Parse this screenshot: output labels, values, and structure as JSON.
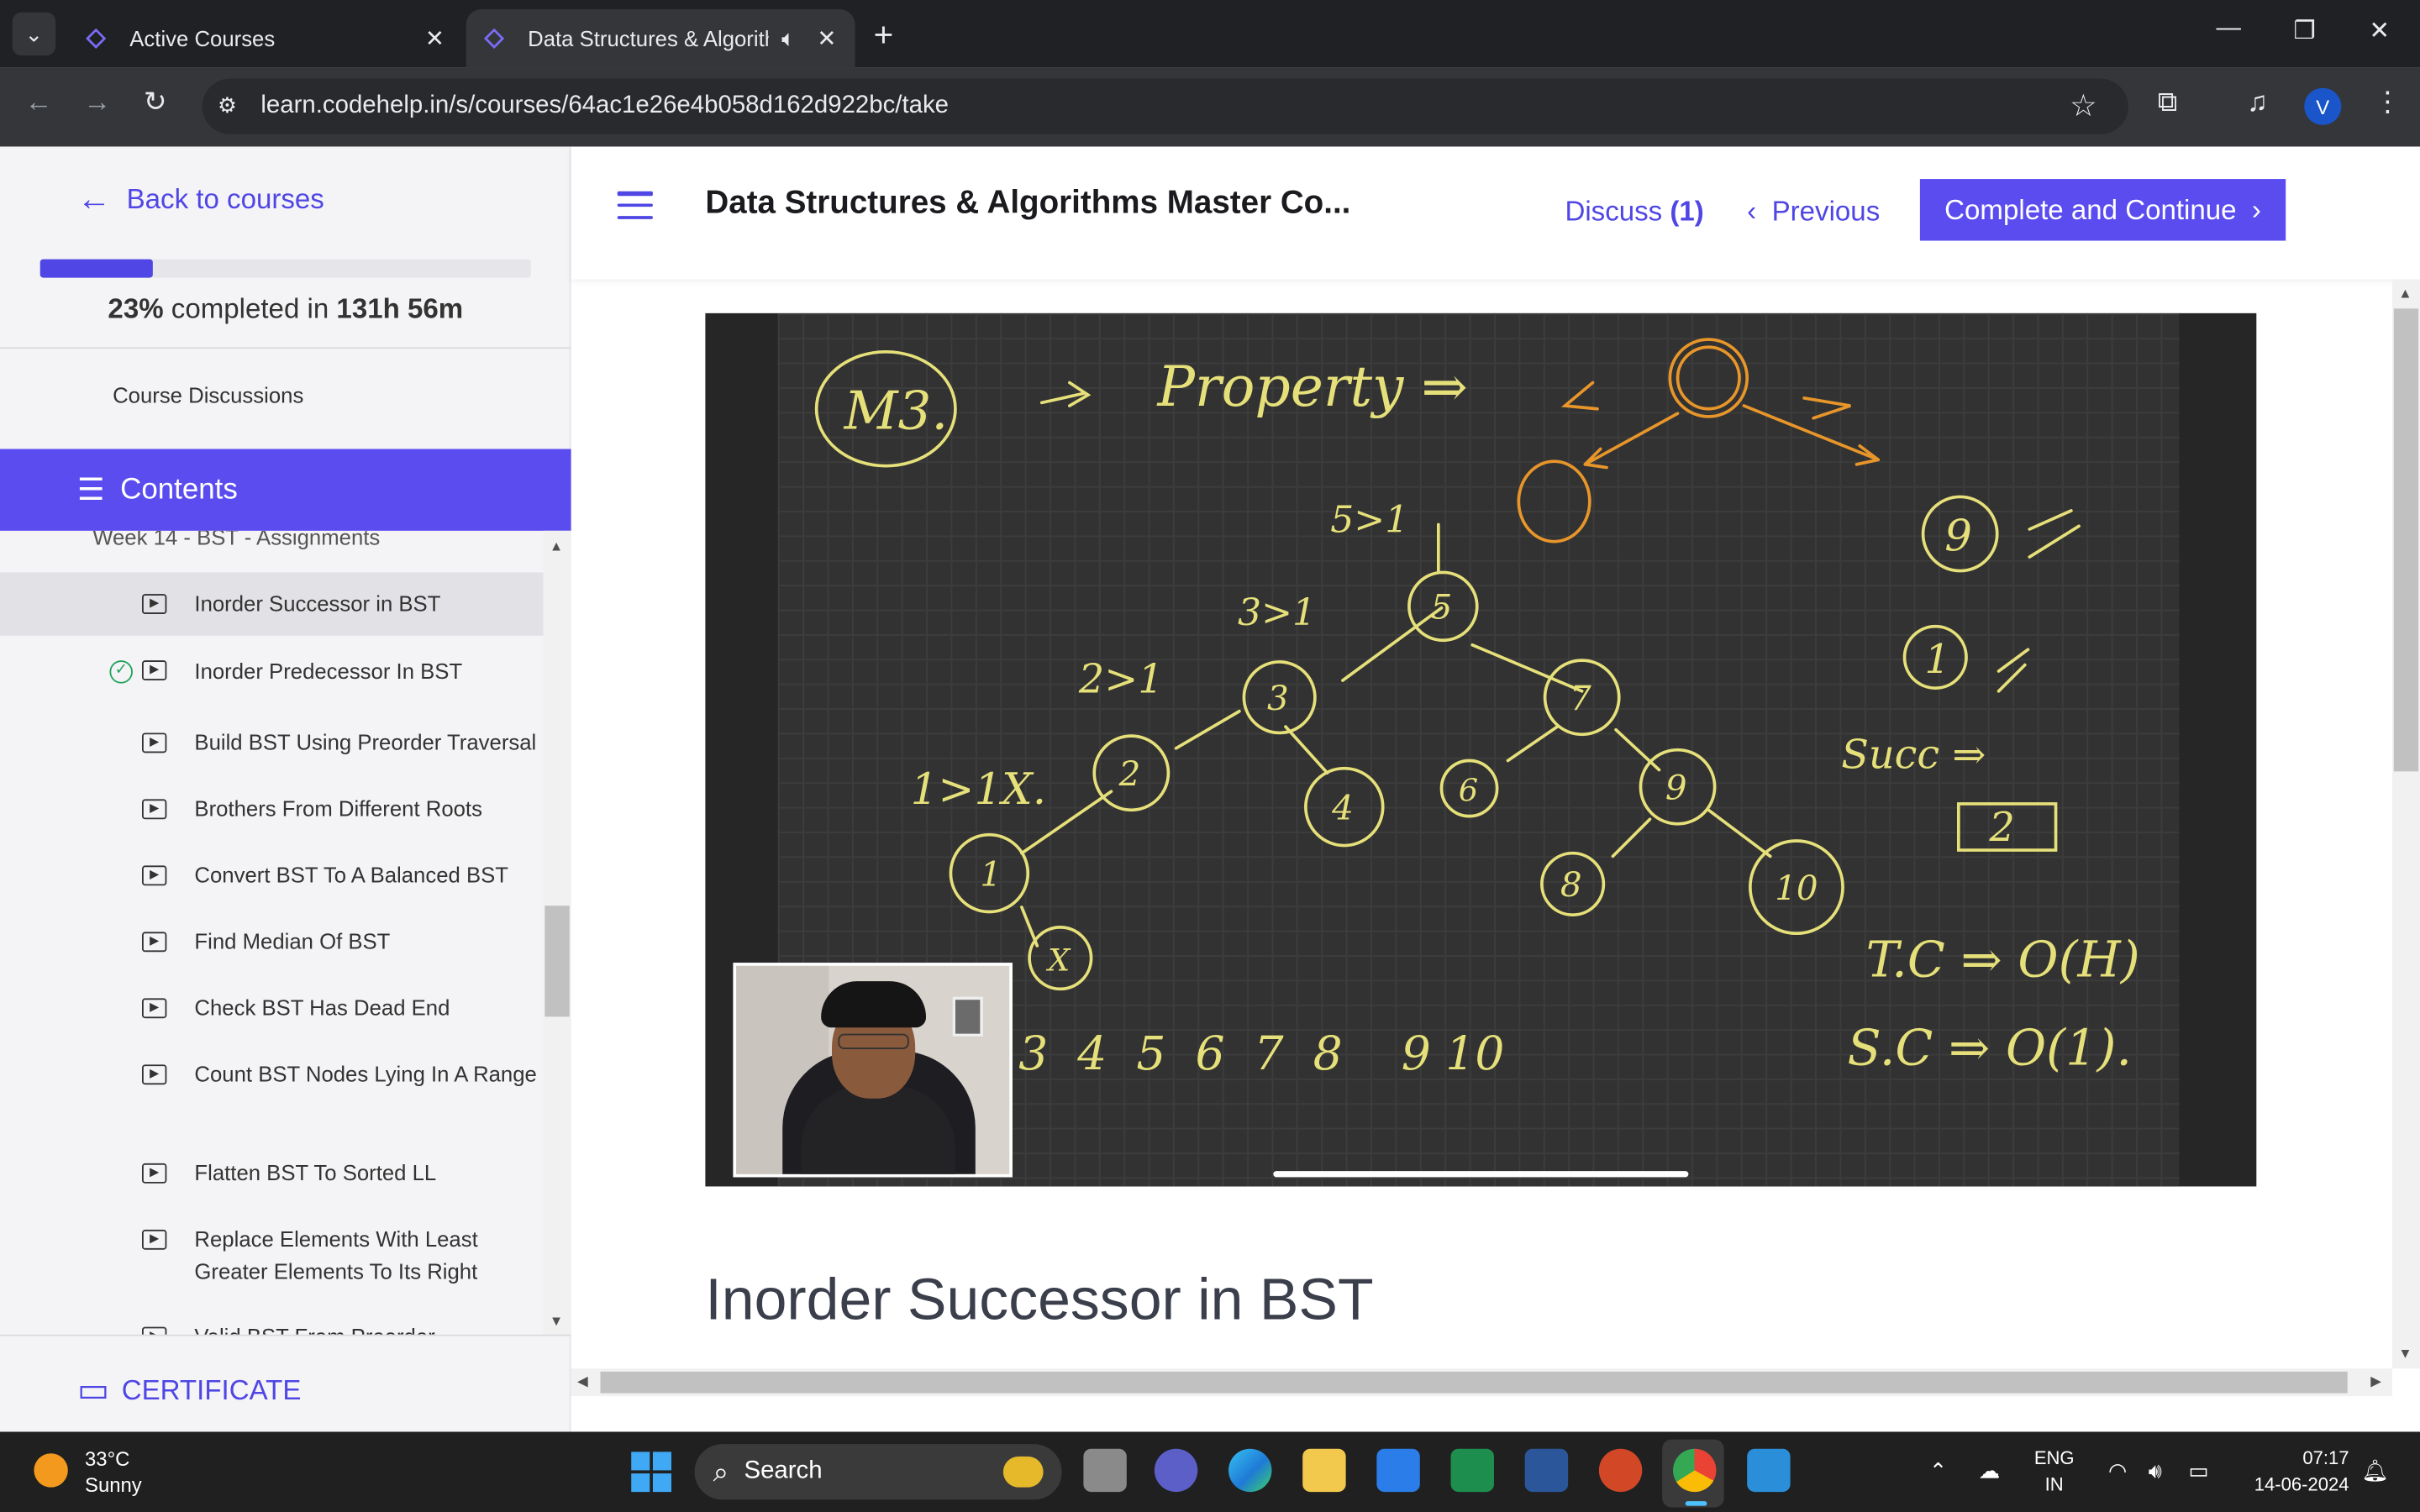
{
  "browser": {
    "tabs": [
      {
        "label": "Active Courses"
      },
      {
        "label": "Data Structures & Algorithm"
      }
    ],
    "url": "learn.codehelp.in/s/courses/64ac1e26e4b058d162d922bc/take",
    "profile_initial": "V"
  },
  "sidebar": {
    "back_label": "Back to courses",
    "progress": {
      "percent": 23,
      "percent_text": "23%",
      "mid_text": " completed in ",
      "time_text": "131h 56m"
    },
    "course_discussions": "Course Discussions",
    "contents_label": "Contents",
    "week_label": "Week 14 - BST - Assignments",
    "items": [
      {
        "title": "Inorder Successor in BST",
        "active": true,
        "done": false
      },
      {
        "title": "Inorder Predecessor In BST",
        "active": false,
        "done": true
      },
      {
        "title": "Build BST Using Preorder Traversal",
        "active": false,
        "done": false
      },
      {
        "title": "Brothers From Different Roots",
        "active": false,
        "done": false
      },
      {
        "title": "Convert BST To A Balanced BST",
        "active": false,
        "done": false
      },
      {
        "title": "Find Median Of BST",
        "active": false,
        "done": false
      },
      {
        "title": "Check BST Has Dead End",
        "active": false,
        "done": false
      },
      {
        "title": "Count BST Nodes Lying In A Range",
        "active": false,
        "done": false
      },
      {
        "title": "Flatten BST To Sorted LL",
        "active": false,
        "done": false
      },
      {
        "title": "Replace Elements With Least Greater Elements To Its Right",
        "active": false,
        "done": false
      },
      {
        "title": "Valid BST From Preorder",
        "active": false,
        "done": false
      }
    ],
    "certificate_label": "CERTIFICATE"
  },
  "header": {
    "course_title": "Data Structures & Algorithms Master Co...",
    "discuss_label": "Discuss",
    "discuss_count": "(1)",
    "previous_label": "Previous",
    "complete_label": "Complete and Continue"
  },
  "video": {
    "board_text": {
      "m3": "M3.",
      "arrow1": "→",
      "property": "Property ⇒",
      "gt_51": "5>1",
      "gt_31": "3>1",
      "gt_21": "2>1",
      "gt_11": "1>1X.",
      "succ": "Succ ⇒",
      "tc": "T.C ⇒ O(H)",
      "sc": "S.C ⇒ O(1).",
      "seq": "3  4  5  6  7  8    9 10",
      "two_box": "2",
      "nine": "9",
      "one": "1",
      "nodes": [
        "5",
        "3",
        "7",
        "2",
        "4",
        "6",
        "9",
        "1",
        "8",
        "10",
        "X"
      ]
    },
    "progress_fraction": 0.27
  },
  "lesson_title": "Inorder Successor in BST",
  "taskbar": {
    "temperature": "33°C",
    "weather": "Sunny",
    "search_placeholder": "Search",
    "lang_line1": "ENG",
    "lang_line2": "IN",
    "time": "07:17",
    "date": "14-06-2024"
  },
  "colors": {
    "accent": "#5b4cf0",
    "link": "#4f46e5",
    "chalk": "#e6e07a",
    "chalk_orange": "#e8962a"
  }
}
